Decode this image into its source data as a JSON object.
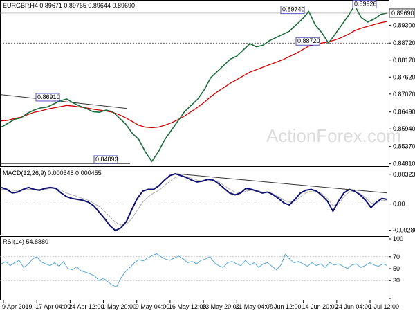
{
  "watermark": "ActionForex.com",
  "chart_data": [
    {
      "type": "line",
      "panel": "price",
      "header": "EURGBP,H4  0.89671 0.89765 0.89644 0.89690",
      "y_ticks": [
        "0.89670",
        "0.89300",
        "0.88720",
        "0.88170",
        "0.87620",
        "0.87070",
        "0.86490",
        "0.85940",
        "0.85370",
        "0.84810"
      ],
      "y_tick_values": [
        0.8967,
        0.893,
        0.8872,
        0.8817,
        0.8762,
        0.8707,
        0.8649,
        0.8594,
        0.8537,
        0.8481
      ],
      "ylim": [
        0.8478,
        0.8998
      ],
      "current_price_label": "0.89690",
      "current_price": 0.8969,
      "level_labels": [
        {
          "text": "0.86910",
          "value": 0.8691
        },
        {
          "text": "0.84893",
          "value": 0.84893
        },
        {
          "text": "0.89740",
          "value": 0.8974
        },
        {
          "text": "0.89926",
          "value": 0.89926
        },
        {
          "text": "0.88720",
          "value": 0.8872
        }
      ],
      "price_series": [
        0.86,
        0.8612,
        0.8625,
        0.863,
        0.8645,
        0.8655,
        0.8662,
        0.8665,
        0.8675,
        0.8685,
        0.8691,
        0.8678,
        0.8668,
        0.866,
        0.865,
        0.8648,
        0.8655,
        0.865,
        0.863,
        0.861,
        0.858,
        0.856,
        0.852,
        0.8489,
        0.852,
        0.856,
        0.859,
        0.862,
        0.865,
        0.867,
        0.869,
        0.872,
        0.876,
        0.878,
        0.88,
        0.882,
        0.883,
        0.885,
        0.887,
        0.886,
        0.8865,
        0.888,
        0.889,
        0.89,
        0.891,
        0.893,
        0.895,
        0.8974,
        0.893,
        0.8905,
        0.8872,
        0.89,
        0.893,
        0.896,
        0.8993,
        0.8955,
        0.894,
        0.895,
        0.8965,
        0.8969
      ],
      "ma_series": [
        0.862,
        0.8622,
        0.8628,
        0.8632,
        0.864,
        0.8648,
        0.8652,
        0.8658,
        0.8662,
        0.8666,
        0.867,
        0.8668,
        0.8665,
        0.8662,
        0.8658,
        0.8655,
        0.8652,
        0.8648,
        0.864,
        0.863,
        0.8618,
        0.8606,
        0.86,
        0.8598,
        0.86,
        0.8606,
        0.8614,
        0.8624,
        0.8636,
        0.865,
        0.8664,
        0.868,
        0.8698,
        0.8714,
        0.8728,
        0.8742,
        0.8754,
        0.8766,
        0.8778,
        0.8786,
        0.8794,
        0.8802,
        0.881,
        0.8818,
        0.8828,
        0.8838,
        0.885,
        0.8862,
        0.8868,
        0.8872,
        0.8876,
        0.8882,
        0.889,
        0.89,
        0.8912,
        0.892,
        0.8926,
        0.8932,
        0.8938,
        0.8942
      ]
    },
    {
      "type": "line",
      "panel": "macd",
      "header": "MACD(12,26,9) 0.000548 0.000455",
      "y_ticks": [
        "0.003239",
        "0.00",
        "-0.002868"
      ],
      "y_tick_values": [
        0.003239,
        0.0,
        -0.002868
      ],
      "ylim": [
        -0.0032,
        0.0036
      ],
      "macd_series": [
        0.0018,
        0.0016,
        0.0012,
        0.0013,
        0.0016,
        0.0018,
        0.0016,
        0.0015,
        0.0017,
        0.0018,
        0.0017,
        0.0012,
        0.0008,
        0.0006,
        0.0005,
        0.0004,
        0.0002,
        -0.0002,
        -0.0009,
        -0.0016,
        -0.0024,
        -0.0029,
        -0.0026,
        -0.0019,
        -0.0006,
        0.0006,
        0.0014,
        0.0016,
        0.0016,
        0.002,
        0.0026,
        0.0031,
        0.0033,
        0.0031,
        0.0029,
        0.0026,
        0.0024,
        0.0025,
        0.0027,
        0.0026,
        0.0022,
        0.0017,
        0.0012,
        0.001,
        0.0012,
        0.0017,
        0.0016,
        0.0014,
        0.0012,
        0.0013,
        0.001,
        0.0006,
        0.0001,
        -0.0001,
        0.0005,
        0.0012,
        0.0015,
        0.0016,
        0.0014,
        0.0009,
        0.0003,
        -0.0008,
        0.0003,
        0.0012,
        0.0016,
        0.0014,
        0.001,
        0.0004,
        -0.0004,
        0.0002,
        0.0006,
        0.0005
      ],
      "signal_series": [
        0.0016,
        0.0016,
        0.0015,
        0.0014,
        0.0015,
        0.0016,
        0.0016,
        0.0016,
        0.0016,
        0.0017,
        0.0017,
        0.0015,
        0.0012,
        0.001,
        0.0008,
        0.0006,
        0.0004,
        0.0001,
        -0.0003,
        -0.0008,
        -0.0014,
        -0.002,
        -0.0023,
        -0.0022,
        -0.0016,
        -0.0007,
        0.0002,
        0.0008,
        0.0012,
        0.0015,
        0.002,
        0.0025,
        0.0029,
        0.003,
        0.003,
        0.0028,
        0.0026,
        0.0025,
        0.0026,
        0.0026,
        0.0024,
        0.002,
        0.0016,
        0.0013,
        0.0012,
        0.0014,
        0.0015,
        0.0015,
        0.0013,
        0.0013,
        0.0011,
        0.0008,
        0.0004,
        0.0002,
        0.0003,
        0.0008,
        0.0012,
        0.0014,
        0.0014,
        0.0011,
        0.0006,
        -0.0002,
        0.0,
        0.0008,
        0.0013,
        0.0014,
        0.0011,
        0.0007,
        0.0001,
        0.0001,
        0.0004,
        0.0004
      ]
    },
    {
      "type": "line",
      "panel": "rsi",
      "header": "RSI(14) 54.8880",
      "y_ticks": [
        "100",
        "70",
        "50",
        "30",
        "0"
      ],
      "y_tick_values": [
        100,
        70,
        50,
        30,
        0
      ],
      "ylim": [
        0,
        100
      ],
      "rsi_series": [
        58,
        62,
        55,
        60,
        64,
        52,
        57,
        66,
        70,
        61,
        58,
        55,
        60,
        54,
        62,
        50,
        48,
        53,
        46,
        44,
        41,
        38,
        30,
        34,
        28,
        22,
        20,
        35,
        45,
        52,
        60,
        65,
        63,
        68,
        72,
        75,
        70,
        66,
        64,
        68,
        71,
        66,
        60,
        62,
        58,
        64,
        66,
        70,
        60,
        55,
        52,
        60,
        62,
        58,
        55,
        64,
        56,
        60,
        52,
        58,
        60,
        54,
        48,
        56,
        74,
        66,
        60,
        62,
        58,
        54,
        60,
        55,
        58,
        52,
        60,
        56,
        58,
        54,
        50,
        56,
        58,
        52,
        55,
        60,
        56,
        54,
        58,
        55
      ],
      "rsi_levels": [
        70,
        30
      ]
    }
  ],
  "x_axis_labels": [
    "9 Apr 2019",
    "17 Apr 04:00",
    "24 Apr 12:00",
    "1 May 20:00",
    "9 May 04:00",
    "16 May 12:00",
    "23 May 20:00",
    "31 May 04:00",
    "7 Jun 12:00",
    "14 Jun 20:00",
    "24 Jun 04:00",
    "1 Jul 12:00"
  ]
}
